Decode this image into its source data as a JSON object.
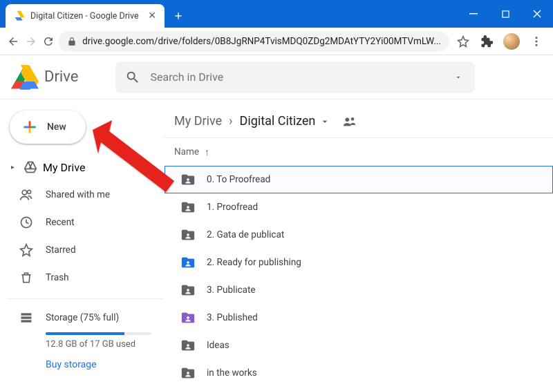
{
  "window": {
    "tab_title": "Digital Citizen - Google Drive"
  },
  "browser": {
    "url": "drive.google.com/drive/folders/0B8JgRNP4TvisMDQ0ZDg2MDAtYTY2Yi00MTVmLW..."
  },
  "header": {
    "product": "Drive",
    "search_placeholder": "Search in Drive"
  },
  "sidebar": {
    "new_label": "New",
    "items": [
      {
        "label": "My Drive"
      },
      {
        "label": "Shared with me"
      },
      {
        "label": "Recent"
      },
      {
        "label": "Starred"
      },
      {
        "label": "Trash"
      }
    ],
    "storage": {
      "title": "Storage (75% full)",
      "used_text": "12.8 GB of 17 GB used",
      "percent": 75,
      "buy_link": "Buy storage"
    }
  },
  "breadcrumb": {
    "root": "My Drive",
    "current": "Digital Citizen"
  },
  "list": {
    "column_name": "Name",
    "rows": [
      {
        "name": "0. To Proofread",
        "color": "#5f6368",
        "selected": true
      },
      {
        "name": "1. Proofread",
        "color": "#5f6368",
        "selected": false
      },
      {
        "name": "2. Gata de publicat",
        "color": "#5f6368",
        "selected": false
      },
      {
        "name": "2. Ready for publishing",
        "color": "#1a73e8",
        "selected": false
      },
      {
        "name": "3. Publicate",
        "color": "#5f6368",
        "selected": false
      },
      {
        "name": "3. Published",
        "color": "#8a5cc9",
        "selected": false
      },
      {
        "name": "Ideas",
        "color": "#5f6368",
        "selected": false
      },
      {
        "name": "in the works",
        "color": "#5f6368",
        "selected": false
      }
    ]
  }
}
